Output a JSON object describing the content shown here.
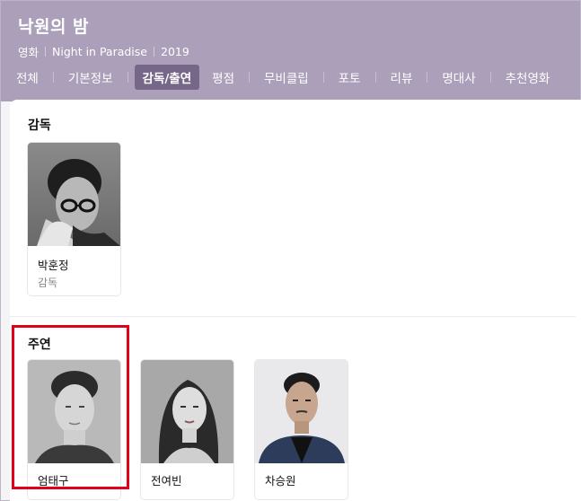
{
  "movie": {
    "title": "낙원의 밤",
    "category": "영화",
    "english_title": "Night in Paradise",
    "year": "2019"
  },
  "tabs": [
    {
      "label": "전체",
      "active": false
    },
    {
      "label": "기본정보",
      "active": false
    },
    {
      "label": "감독/출연",
      "active": true
    },
    {
      "label": "평점",
      "active": false
    },
    {
      "label": "무비클립",
      "active": false
    },
    {
      "label": "포토",
      "active": false
    },
    {
      "label": "리뷰",
      "active": false
    },
    {
      "label": "명대사",
      "active": false
    },
    {
      "label": "추천영화",
      "active": false
    }
  ],
  "director_section": {
    "title": "감독",
    "people": [
      {
        "name": "박훈정",
        "role": "감독"
      }
    ]
  },
  "cast_section": {
    "title": "주연",
    "people": [
      {
        "name": "엄태구"
      },
      {
        "name": "전여빈"
      },
      {
        "name": "차승원"
      }
    ]
  },
  "colors": {
    "header_bg": "#ab9fba",
    "active_tab_bg": "#766788",
    "highlight_border": "#e0001a"
  }
}
